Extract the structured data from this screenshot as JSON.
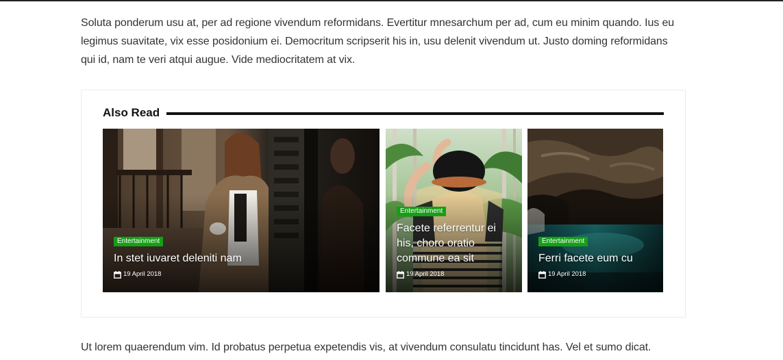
{
  "article": {
    "paragraph_top": "Soluta ponderum usu at, per ad regione vivendum reformidans. Evertitur mnesarchum per ad, cum eu minim quando. Ius eu legimus suavitate, vix esse posidonium ei. Democritum scripserit his in, usu delenit vivendum ut. Justo doming reformidans qui id, nam te veri atqui augue. Vide mediocritatem at vix.",
    "paragraph_bottom": "Ut lorem quaerendum vim. Id probatus perpetua expetendis vis, at vivendum consulatu tincidunt has. Vel et sumo dicat."
  },
  "also_read": {
    "heading": "Also Read",
    "cards": [
      {
        "category": "Entertainment",
        "title": "In stet iuvaret deleniti nam",
        "date": "19 April 2018"
      },
      {
        "category": "Entertainment",
        "title": "Facete referrentur ei his, choro oratio commune ea sit",
        "date": "19 April 2018"
      },
      {
        "category": "Entertainment",
        "title": "Ferri facete eum cu",
        "date": "19 April 2018"
      }
    ]
  },
  "colors": {
    "badge_green": "#13a014",
    "text": "#333333",
    "heading": "#111111"
  },
  "icons": {
    "date": "calendar-icon"
  }
}
